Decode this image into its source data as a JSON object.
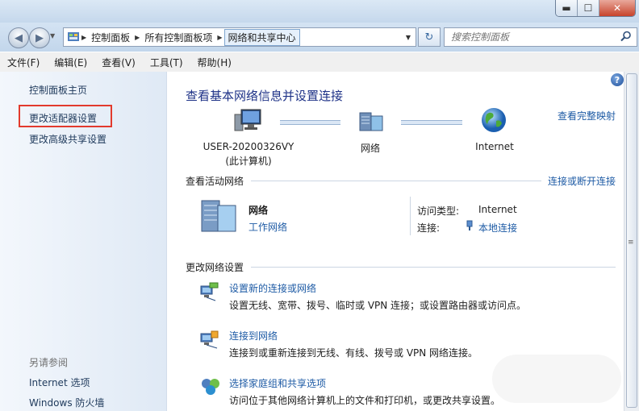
{
  "window": {
    "min": "▬",
    "max": "☐",
    "close": "✕"
  },
  "nav": {
    "breadcrumb": [
      "控制面板",
      "所有控制面板项",
      "网络和共享中心"
    ],
    "search_placeholder": "搜索控制面板"
  },
  "menu": [
    "文件(F)",
    "编辑(E)",
    "查看(V)",
    "工具(T)",
    "帮助(H)"
  ],
  "sidebar": {
    "items": [
      "控制面板主页",
      "更改适配器设置",
      "更改高级共享设置"
    ],
    "see_also_title": "另请参阅",
    "see_also": [
      "Internet 选项",
      "Windows 防火墙"
    ]
  },
  "main": {
    "title": "查看基本网络信息并设置连接",
    "full_map": "查看完整映射",
    "diagram": {
      "computer_line1": "USER-20200326VY",
      "computer_line2": "(此计算机)",
      "network": "网络",
      "internet": "Internet"
    },
    "active": {
      "header": "查看活动网络",
      "action": "连接或断开连接",
      "name": "网络",
      "type": "工作网络",
      "access_label": "访问类型:",
      "access_value": "Internet",
      "conn_label": "连接:",
      "conn_value": "本地连接"
    },
    "change": {
      "header": "更改网络设置",
      "tasks": [
        {
          "title": "设置新的连接或网络",
          "desc": "设置无线、宽带、拨号、临时或 VPN 连接；或设置路由器或访问点。"
        },
        {
          "title": "连接到网络",
          "desc": "连接到或重新连接到无线、有线、拨号或 VPN 网络连接。"
        },
        {
          "title": "选择家庭组和共享选项",
          "desc": "访问位于其他网络计算机上的文件和打印机，或更改共享设置。"
        }
      ]
    }
  }
}
